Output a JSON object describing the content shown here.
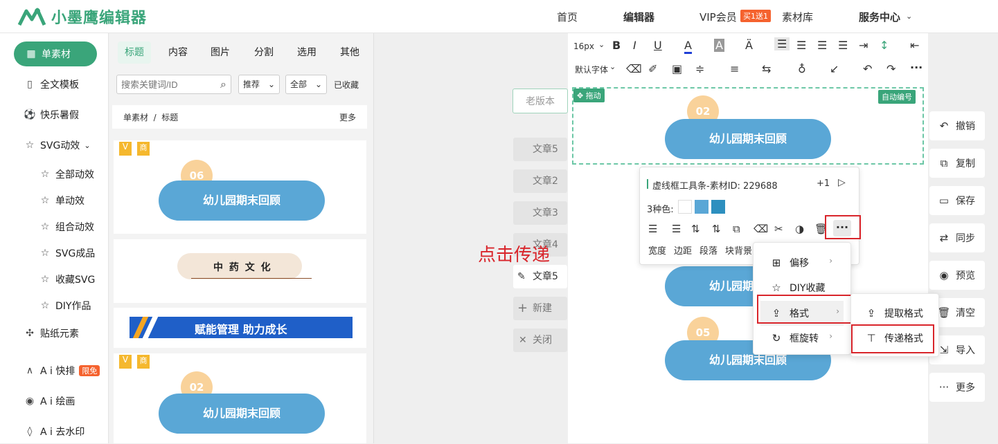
{
  "app": {
    "logo_text": "小墨鹰编辑器",
    "accent": "#3aa57a"
  },
  "nav": {
    "items": [
      "首页",
      "编辑器",
      "VIP会员",
      "素材库",
      "服务中心"
    ],
    "vip_badge": "买1送1"
  },
  "sidebar": {
    "items": [
      "单素材",
      "全文模板",
      "快乐暑假",
      "SVG动效",
      "全部动效",
      "单动效",
      "组合动效",
      "SVG成品",
      "收藏SVG",
      "DIY作品",
      "贴纸元素",
      "A i 快排",
      "A i 绘画",
      "A i 去水印"
    ],
    "free_badge": "限免"
  },
  "panel": {
    "tabs": [
      "标题",
      "内容",
      "图片",
      "分割",
      "选用",
      "其他"
    ],
    "search_placeholder": "搜索关键词/ID",
    "filter1": "推荐",
    "filter2": "全部",
    "favorites": "已收藏",
    "breadcrumb": "单素材  /  标题",
    "more": "更多",
    "cards": {
      "badge1": "商",
      "num1": "06",
      "title1": "幼儿园期末回顾",
      "text2": "中 药 文 化",
      "text3": "赋能管理 助力成长",
      "badge4": "商",
      "num4": "02",
      "title4": "幼儿园期末回顾"
    }
  },
  "editor": {
    "font_size": "16px",
    "default_font": "默认字体",
    "drag_label": "拖动",
    "auto_number": "自动编号",
    "block1_num": "02",
    "block_title": "幼儿园期末回顾",
    "block3_num": "05"
  },
  "left_docs": {
    "old_version": "老版本",
    "docs": [
      "文章5",
      "文章2",
      "文章3",
      "文章4",
      "文章5"
    ],
    "new": "新建",
    "close": "关闭"
  },
  "annotation": "点击传递",
  "popover": {
    "title": "虚线框工具条-素材ID: 229688",
    "plus": "+1",
    "colors_label": "3种色:",
    "colors": [
      "#ffffff",
      "#5aa7d6",
      "#2d8fbf"
    ],
    "actions": [
      "宽度",
      "边距",
      "段落",
      "块背景"
    ]
  },
  "menu": {
    "items": [
      "偏移",
      "DIY收藏",
      "格式",
      "框旋转"
    ],
    "sub": [
      "提取格式",
      "传递格式"
    ]
  },
  "right_actions": [
    "撤销",
    "复制",
    "保存",
    "同步",
    "预览",
    "清空",
    "导入",
    "更多"
  ]
}
